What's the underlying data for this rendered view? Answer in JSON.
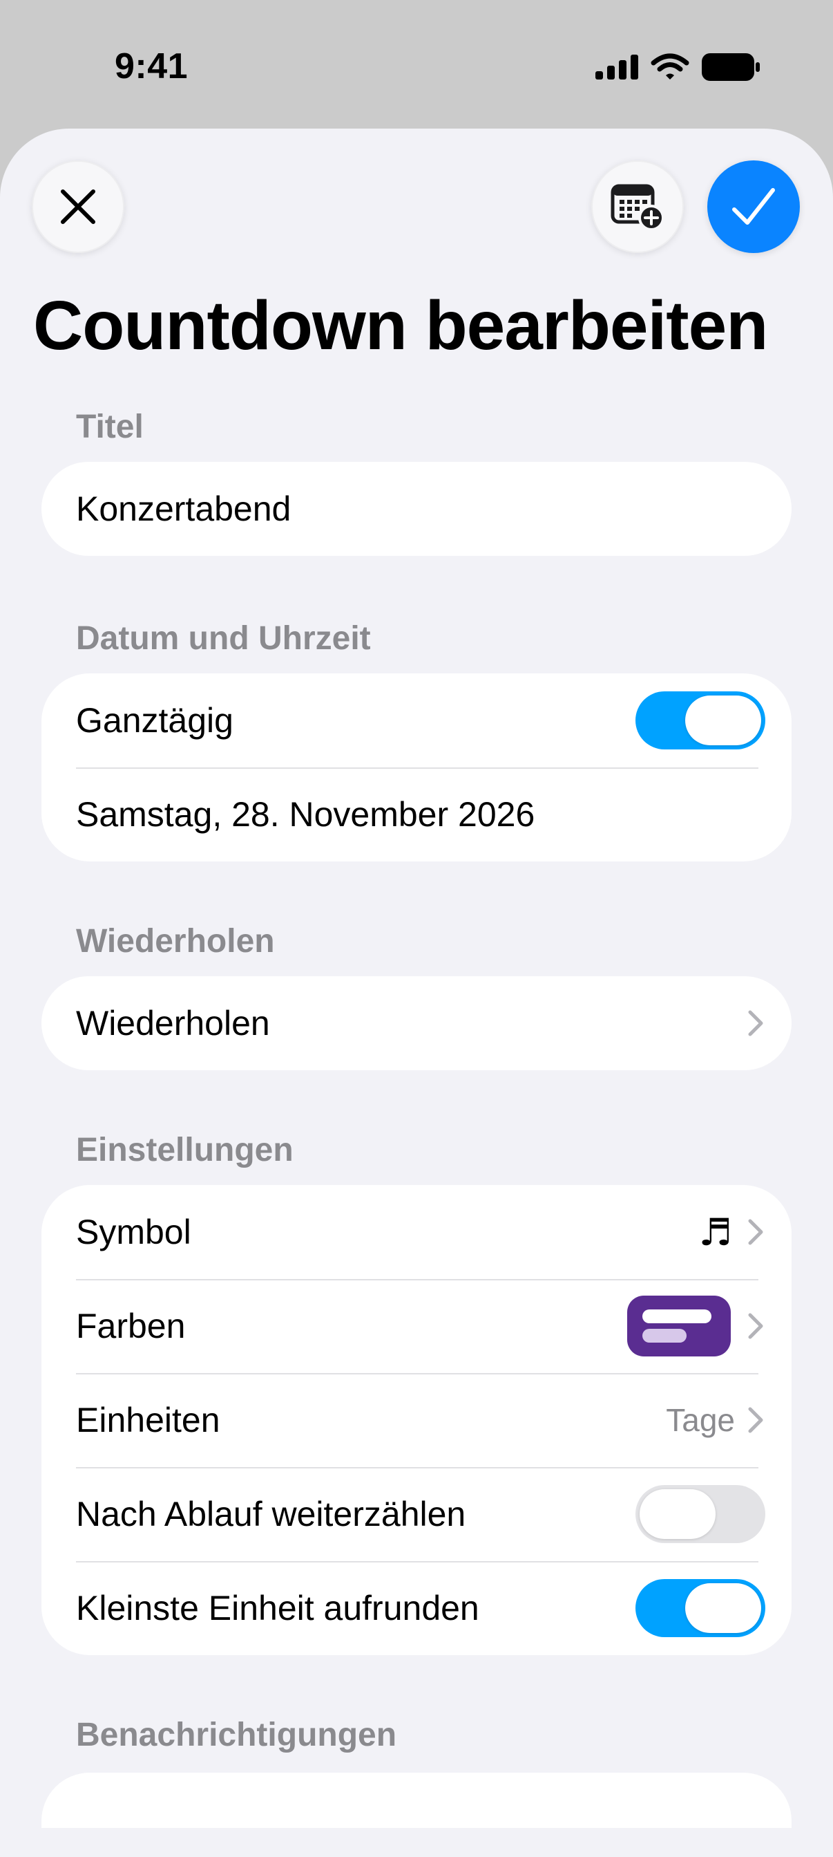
{
  "status": {
    "time": "9:41"
  },
  "title": "Countdown bearbeiten",
  "sections": {
    "title_header": "Titel",
    "title_value": "Konzertabend",
    "date_header": "Datum und Uhrzeit",
    "allday_label": "Ganztägig",
    "allday_on": true,
    "date_value": "Samstag, 28. November 2026",
    "repeat_header": "Wiederholen",
    "repeat_label": "Wiederholen",
    "settings_header": "Einstellungen",
    "symbol_label": "Symbol",
    "symbol_glyph": "♬",
    "colors_label": "Farben",
    "color_swatch": "#5a2d91",
    "units_label": "Einheiten",
    "units_value": "Tage",
    "continue_label": "Nach Ablauf weiterzählen",
    "continue_on": false,
    "roundup_label": "Kleinste Einheit aufrunden",
    "roundup_on": true,
    "notifications_header": "Benachrichtigungen"
  },
  "colors": {
    "accent": "#0a84ff",
    "toggle_on": "#00a2ff",
    "sheet_bg": "#f2f2f7"
  },
  "icons": [
    "close-icon",
    "calendar-add-icon",
    "checkmark-icon",
    "chevron-right-icon",
    "music-note-icon"
  ]
}
